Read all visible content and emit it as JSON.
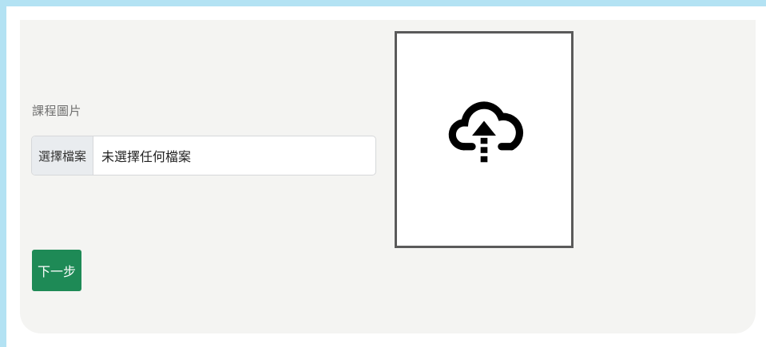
{
  "form": {
    "field_label": "課程圖片",
    "file_button_label": "選擇檔案",
    "file_name_value": "未選擇任何檔案"
  },
  "preview": {
    "icon": "cloud-upload-icon"
  },
  "actions": {
    "next_label": "下一步"
  },
  "colors": {
    "accent": "#1e8a56",
    "panel_bg": "#f4f4f2",
    "frame_strip": "#b3e2f3"
  }
}
